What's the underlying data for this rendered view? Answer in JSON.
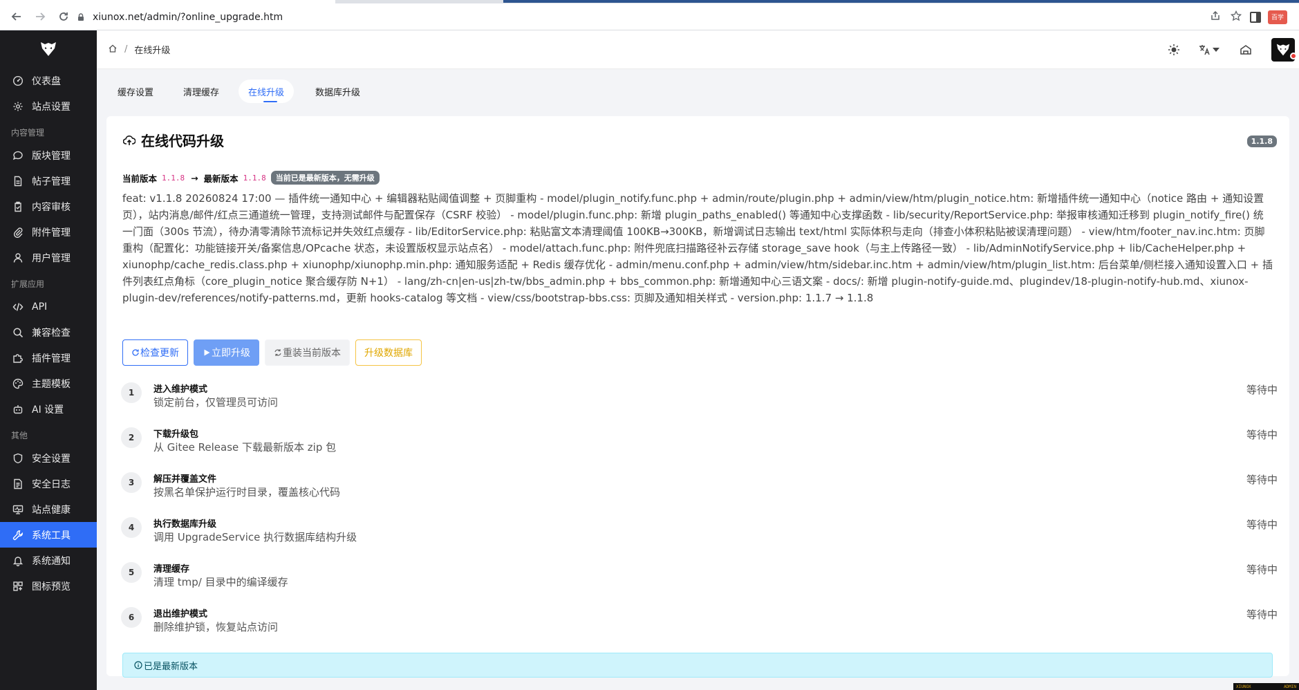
{
  "browser": {
    "url": "xiunox.net/admin/?online_upgrade.htm",
    "extension_badge": "百学"
  },
  "sidebar": {
    "items_top": [
      {
        "label": "仪表盘",
        "icon": "dashboard-icon"
      },
      {
        "label": "站点设置",
        "icon": "gear-icon"
      }
    ],
    "group_content": "内容管理",
    "items_content": [
      {
        "label": "版块管理",
        "icon": "chat-icon"
      },
      {
        "label": "帖子管理",
        "icon": "document-icon"
      },
      {
        "label": "内容审核",
        "icon": "clipboard-check-icon"
      },
      {
        "label": "附件管理",
        "icon": "paperclip-icon"
      },
      {
        "label": "用户管理",
        "icon": "user-icon"
      }
    ],
    "group_ext": "扩展应用",
    "items_ext": [
      {
        "label": "API",
        "icon": "code-icon"
      },
      {
        "label": "兼容检查",
        "icon": "search-icon"
      },
      {
        "label": "插件管理",
        "icon": "puzzle-icon"
      },
      {
        "label": "主题模板",
        "icon": "palette-icon"
      },
      {
        "label": "AI 设置",
        "icon": "robot-icon"
      }
    ],
    "group_other": "其他",
    "items_other": [
      {
        "label": "安全设置",
        "icon": "shield-icon"
      },
      {
        "label": "安全日志",
        "icon": "log-icon"
      },
      {
        "label": "站点健康",
        "icon": "monitor-icon"
      },
      {
        "label": "系统工具",
        "icon": "wrench-icon",
        "active": true
      },
      {
        "label": "系统通知",
        "icon": "bell-icon"
      },
      {
        "label": "图标预览",
        "icon": "grid-icon"
      }
    ]
  },
  "header": {
    "breadcrumb_current": "在线升级"
  },
  "tabs": [
    {
      "label": "缓存设置"
    },
    {
      "label": "清理缓存"
    },
    {
      "label": "在线升级",
      "active": true
    },
    {
      "label": "数据库升级"
    }
  ],
  "card": {
    "title": "在线代码升级",
    "version_badge": "1.1.8",
    "current_label": "当前版本",
    "current_version": "1.1.8",
    "arrow": "→",
    "latest_label": "最新版本",
    "latest_version": "1.1.8",
    "status": "当前已是最新版本，无需升级",
    "changelog": "feat: v1.1.8 20260824 17:00 — 插件统一通知中心 + 编辑器粘贴阈值调整 + 页脚重构 - model/plugin_notify.func.php + admin/route/plugin.php + admin/view/htm/plugin_notice.htm: 新增插件统一通知中心（notice 路由 + 通知设置页），站内消息/邮件/红点三通道统一管理，支持测试邮件与配置保存（CSRF 校验） - model/plugin.func.php: 新增 plugin_paths_enabled() 等通知中心支撑函数 - lib/security/ReportService.php: 举报审核通知迁移到 plugin_notify_fire() 统一门面（300s 节流），待办清零清除节流标记并失效红点缓存 - lib/EditorService.php: 粘贴富文本清理阈值 100KB→300KB，新增调试日志输出 text/html 实际体积与走向（排查小体积粘贴被误清理问题） - view/htm/footer_nav.inc.htm: 页脚重构（配置化：功能链接开关/备案信息/OPcache 状态，未设置版权显示站点名） - model/attach.func.php: 附件兜底扫描路径补云存储 storage_save hook（与主上传路径一致） - lib/AdminNotifyService.php + lib/CacheHelper.php + xiunophp/cache_redis.class.php + xiunophp/xiunophp.min.php: 通知服务适配 + Redis 缓存优化 - admin/menu.conf.php + admin/view/htm/sidebar.inc.htm + admin/view/htm/plugin_list.htm: 后台菜单/侧栏接入通知设置入口 + 插件列表红点角标（core_plugin_notice 聚合缓存防 N+1） - lang/zh-cn|en-us|zh-tw/bbs_admin.php + bbs_common.php: 新增通知中心三语文案 - docs/: 新增 plugin-notify-guide.md、plugindev/18-plugin-notify-hub.md、xiunox-plugin-dev/references/notify-patterns.md，更新 hooks-catalog 等文档 - view/css/bootstrap-bbs.css: 页脚及通知相关样式 - version.php: 1.1.7 → 1.1.8",
    "buttons": {
      "check": "检查更新",
      "upgrade": "立即升级",
      "reinstall": "重装当前版本",
      "db": "升级数据库"
    },
    "steps": [
      {
        "num": "1",
        "title": "进入维护模式",
        "desc": "锁定前台，仅管理员可访问",
        "state": "等待中"
      },
      {
        "num": "2",
        "title": "下载升级包",
        "desc": "从 Gitee Release 下载最新版本 zip 包",
        "state": "等待中"
      },
      {
        "num": "3",
        "title": "解压并覆盖文件",
        "desc": "按黑名单保护运行时目录，覆盖核心代码",
        "state": "等待中"
      },
      {
        "num": "4",
        "title": "执行数据库升级",
        "desc": "调用 UpgradeService 执行数据库结构升级",
        "state": "等待中"
      },
      {
        "num": "5",
        "title": "清理缓存",
        "desc": "清理 tmp/ 目录中的编译缓存",
        "state": "等待中"
      },
      {
        "num": "6",
        "title": "退出维护模式",
        "desc": "删除维护锁，恢复站点访问",
        "state": "等待中"
      }
    ],
    "alert": "已是最新版本"
  },
  "corner_badge": {
    "left": "XIUNOX",
    "right": "ADMIN"
  },
  "colors": {
    "sidebar_bg": "#1c1c1f",
    "accent": "#2f6df6",
    "warning": "#f5c443",
    "info_bg": "#cff4fc"
  }
}
